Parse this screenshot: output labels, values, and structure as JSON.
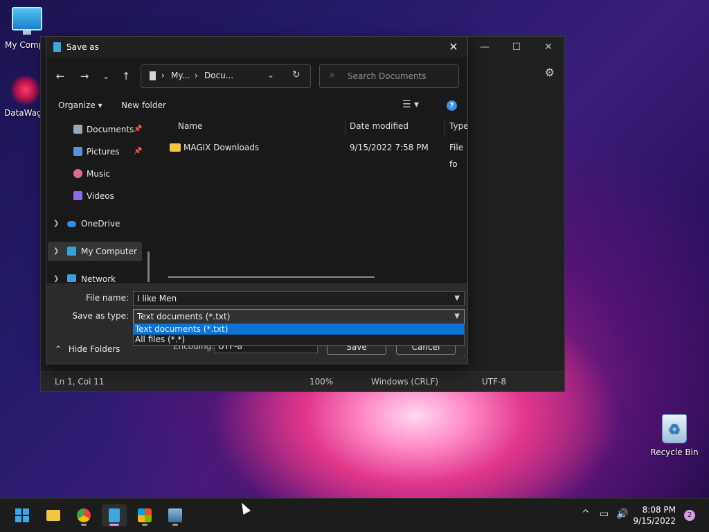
{
  "desktop": {
    "icons": [
      {
        "label": "My Compu",
        "icon": "computer-icon"
      },
      {
        "label": "DataWago",
        "icon": "datawago-app-icon"
      },
      {
        "label": "Recycle Bin",
        "icon": "recycle-bin-icon"
      }
    ]
  },
  "notepad": {
    "caption_buttons": {
      "minimize": "—",
      "maximize": "☐",
      "close": "✕"
    },
    "status": {
      "position": "Ln 1, Col 11",
      "zoom": "100%",
      "line_endings": "Windows (CRLF)",
      "encoding": "UTF-8"
    }
  },
  "dialog": {
    "title": "Save as",
    "close_glyph": "✕",
    "nav_buttons": {
      "back": "←",
      "forward": "→",
      "recent": "⌄",
      "up": "↑"
    },
    "breadcrumb": [
      "My...",
      "Docu..."
    ],
    "search_placeholder": "Search Documents",
    "commands": {
      "organize": "Organize ▾",
      "new_folder": "New folder"
    },
    "nav_pane": [
      {
        "label": "Documents",
        "pinned": true,
        "icon": "documents-icon",
        "color": "#9aa7b5"
      },
      {
        "label": "Pictures",
        "pinned": true,
        "icon": "pictures-icon",
        "color": "#5b8fe0"
      },
      {
        "label": "Music",
        "pinned": false,
        "icon": "music-icon",
        "color": "#e06b8c"
      },
      {
        "label": "Videos",
        "pinned": false,
        "icon": "videos-icon",
        "color": "#8d6be0"
      },
      {
        "label": "OneDrive",
        "pinned": false,
        "icon": "onedrive-icon",
        "color": "#2f8ee8"
      },
      {
        "label": "My Computer",
        "pinned": false,
        "icon": "computer-icon",
        "color": "#3aa0d8",
        "selected": true
      },
      {
        "label": "Network",
        "pinned": false,
        "icon": "network-icon",
        "color": "#3aa0d8"
      }
    ],
    "columns": {
      "name": "Name",
      "date_modified": "Date modified",
      "type": "Type"
    },
    "files": [
      {
        "name": "MAGIX Downloads",
        "date_modified": "9/15/2022 7:58 PM",
        "type": "File fo"
      }
    ],
    "file_name_label": "File name:",
    "file_name_value": "I like Men",
    "save_type_label": "Save as type:",
    "save_type_value": "Text documents (*.txt)",
    "save_type_options": [
      "Text documents (*.txt)",
      "All files  (*.*)"
    ],
    "encoding_label": "Encoding:",
    "encoding_value": "UTF-8",
    "save_button": "Save",
    "cancel_button": "Cancel",
    "hide_folders": "Hide Folders"
  },
  "taskbar": {
    "apps": [
      "start-icon",
      "file-explorer-icon",
      "chrome-icon",
      "notepad-icon",
      "store-icon",
      "app-icon"
    ],
    "tray_chevron": "^",
    "time": "8:08 PM",
    "date": "9/15/2022",
    "notification_count": "2"
  }
}
